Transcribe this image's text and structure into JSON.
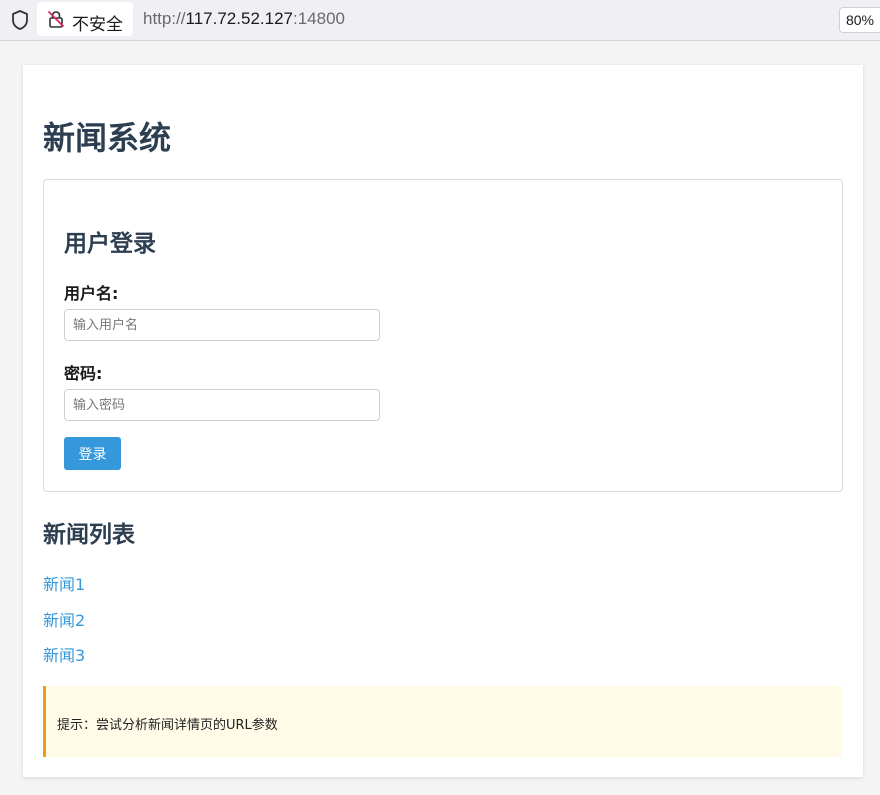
{
  "browser": {
    "security_label": "不安全",
    "url_scheme": "http://",
    "url_host": "117.72.52.127",
    "url_port": ":14800",
    "zoom": "80%"
  },
  "page": {
    "title": "新闻系统",
    "login": {
      "heading": "用户登录",
      "username_label": "用户名:",
      "username_placeholder": "输入用户名",
      "username_value": "",
      "password_label": "密码:",
      "password_placeholder": "输入密码",
      "password_value": "",
      "submit_label": "登录"
    },
    "news": {
      "heading": "新闻列表",
      "items": [
        {
          "label": "新闻1"
        },
        {
          "label": "新闻2"
        },
        {
          "label": "新闻3"
        }
      ]
    },
    "hint": "提示：尝试分析新闻详情页的URL参数"
  },
  "colors": {
    "accent": "#3498db",
    "heading": "#2c3e50",
    "hint_border": "#f39c12",
    "hint_bg": "#fffbe6"
  }
}
